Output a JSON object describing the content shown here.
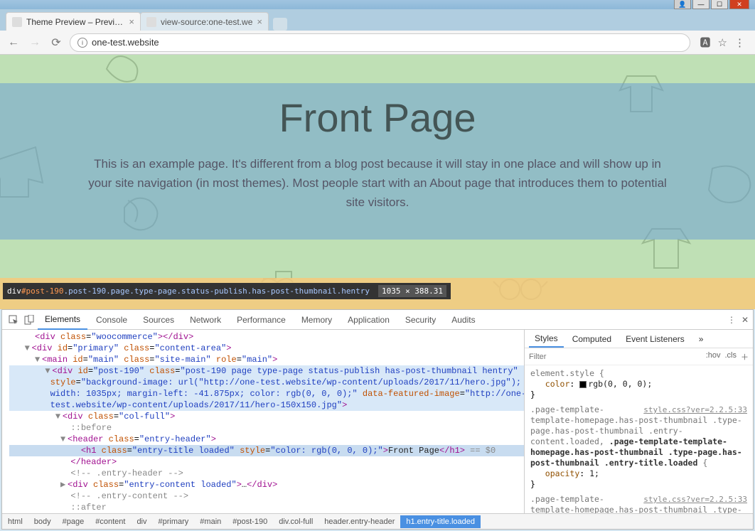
{
  "window": {
    "tabs": [
      {
        "title": "Theme Preview – Preview",
        "active": true
      },
      {
        "title": "view-source:one-test.we",
        "active": false
      }
    ]
  },
  "omnibar": {
    "url": "one-test.website"
  },
  "page": {
    "title": "Front Page",
    "description": "This is an example page. It's different from a blog post because it will stay in one place and will show up in your site navigation (in most themes). Most people start with an About page that introduces them to potential site visitors."
  },
  "tooltip": {
    "selector_prefix": "div",
    "selector_id": "#post-190",
    "selector_classes": ".post-190.page.type-page.status-publish.has-post-thumbnail.hentry",
    "dims": "1035 × 388.31"
  },
  "devtools": {
    "tabs": [
      "Elements",
      "Console",
      "Sources",
      "Network",
      "Performance",
      "Memory",
      "Application",
      "Security",
      "Audits"
    ],
    "active_tab": "Elements",
    "side_tabs": [
      "Styles",
      "Computed",
      "Event Listeners"
    ],
    "active_side_tab": "Styles",
    "filter_placeholder": "Filter",
    "hov": ":hov",
    "cls": ".cls",
    "elements": {
      "l1_open": "<div class=\"woocommerce\">",
      "l1_close": "</div>",
      "l2": "<div id=\"primary\" class=\"content-area\">",
      "l3": "<main id=\"main\" class=\"site-main\" role=\"main\">",
      "l4a": "<div id=\"post-190\" class=\"post-190 page type-page status-publish has-post-thumbnail hentry\"",
      "l4b": "style=\"background-image: url(\"http://one-test.website/wp-content/uploads/2017/11/hero.jpg\");",
      "l4c": "width: 1035px; margin-left: -41.875px; color: rgb(0, 0, 0);\" data-featured-image=\"http://one-",
      "l4d": "test.website/wp-content/uploads/2017/11/hero-150x150.jpg\">",
      "l5": "<div class=\"col-full\">",
      "l6": "::before",
      "l7": "<header class=\"entry-header\">",
      "l8_open": "<h1 class=\"entry-title loaded\" style=\"color: rgb(0, 0, 0);\">",
      "l8_text": "Front Page",
      "l8_close": "</h1>",
      "l8_eq": " == $0",
      "l9": "</header>",
      "l10": "<!-- .entry-header -->",
      "l11_open": "<div class=\"entry-content loaded\">",
      "l11_mid": "…",
      "l11_close": "</div>",
      "l12": "<!-- .entry-content -->",
      "l13": "::after",
      "l14": "</div>"
    },
    "styles": {
      "rule1_sel": "element.style {",
      "rule1_prop": "color",
      "rule1_val": "rgb(0, 0, 0);",
      "rule1_close": "}",
      "rule2_link": "style.css?ver=2.2.5:33",
      "rule2_sel": ".page-template-template-homepage.has-post-thumbnail .type-page.has-post-thumbnail .entry-content.loaded, .page-template-template-homepage.has-post-thumbnail .type-page.has-post-thumbnail .entry-title.loaded {",
      "rule2_prop": "opacity",
      "rule2_val": "1;",
      "rule2_close": "}",
      "rule3_link": "style.css?ver=2.2.5:33",
      "rule3_sel": ".page-template-template-homepage.has-post-thumbnail .type-page.has-post-thumbnail .entry-header, .entry-content,"
    },
    "breadcrumb": [
      "html",
      "body",
      "#page",
      "#content",
      "div",
      "#primary",
      "#main",
      "#post-190",
      "div.col-full",
      "header.entry-header",
      "h1.entry-title.loaded"
    ]
  }
}
